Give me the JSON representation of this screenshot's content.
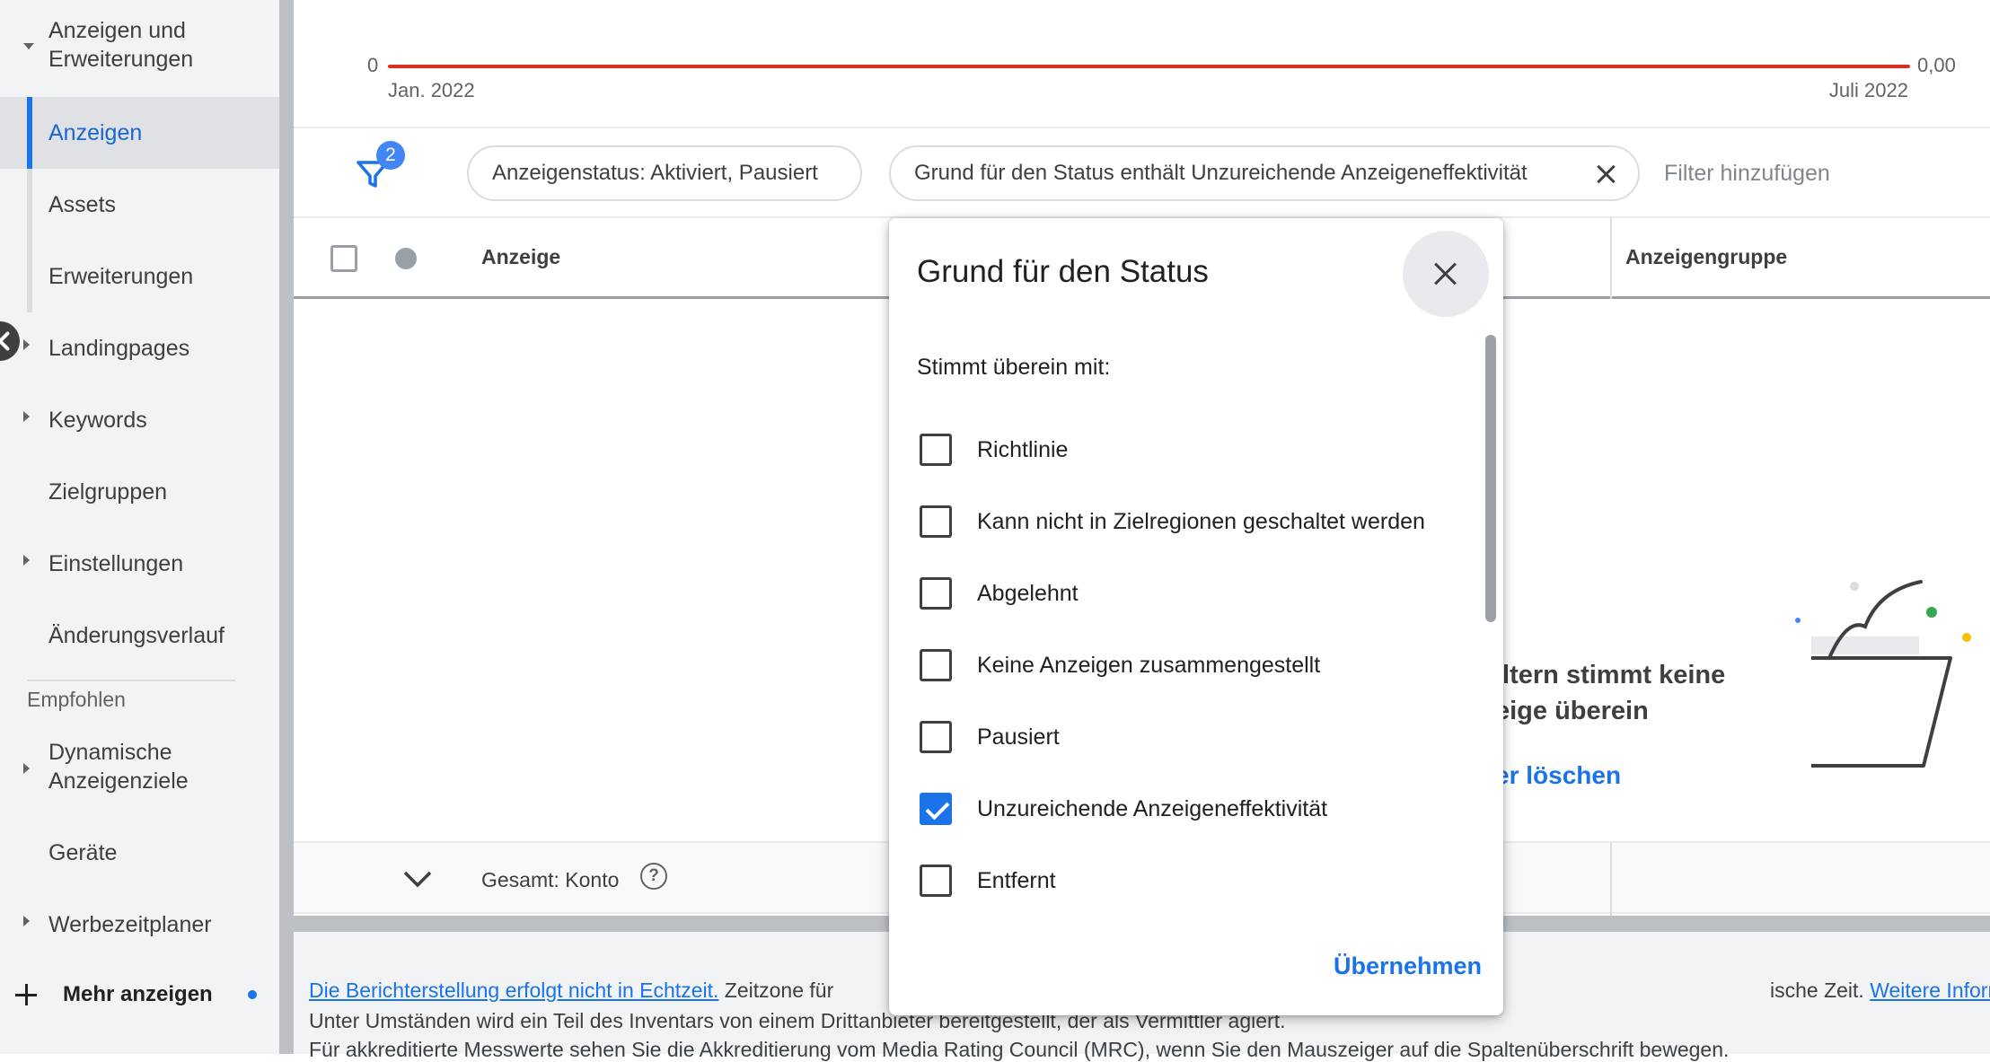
{
  "sidebar": {
    "items": [
      {
        "label": "Anzeigen und Erweiterungen",
        "caret": "down"
      },
      {
        "label": "Anzeigen",
        "active": true
      },
      {
        "label": "Assets"
      },
      {
        "label": "Erweiterungen"
      },
      {
        "label": "Landingpages",
        "caret": "right"
      },
      {
        "label": "Keywords",
        "caret": "right"
      },
      {
        "label": "Zielgruppen"
      },
      {
        "label": "Einstellungen",
        "caret": "right"
      },
      {
        "label": "Änderungsverlauf"
      }
    ],
    "section_label": "Empfohlen",
    "recommended": [
      {
        "label": "Dynamische Anzeigenziele",
        "caret": "right"
      },
      {
        "label": "Geräte"
      },
      {
        "label": "Werbezeitplaner",
        "caret": "right"
      }
    ],
    "more_label": "Mehr anzeigen"
  },
  "chart": {
    "y_left": "0",
    "y_right": "0,00",
    "x_start": "Jan. 2022",
    "x_end": "Juli 2022",
    "line_color": "#d93025"
  },
  "filter_bar": {
    "filter_count": "2",
    "chips": [
      {
        "label": "Anzeigenstatus: Aktiviert, Pausiert"
      },
      {
        "label": "Grund für den Status enthält Unzureichende Anzeigeneffektivität"
      }
    ],
    "add_filter_label": "Filter hinzufügen"
  },
  "table": {
    "columns": [
      "Anzeige",
      "Anzeigengruppe"
    ],
    "empty_line1": "iltern stimmt keine",
    "empty_line2": "eige überein",
    "empty_link": "er löschen",
    "total_label": "Gesamt: Konto"
  },
  "footer": {
    "line1_link": "Die Berichterstellung erfolgt nicht in Echtzeit.",
    "line1_text": "Zeitzone für",
    "line1_text2": "ische Zeit.",
    "line1_link2": "Weitere Informationen",
    "line2": "Unter Umständen wird ein Teil des Inventars von einem Drittanbieter bereitgestellt, der als Vermittler agiert.",
    "line3": "Für akkreditierte Messwerte sehen Sie die Akkreditierung vom Media Rating Council (MRC), wenn Sie den Mauszeiger auf die Spaltenüberschrift bewegen."
  },
  "dialog": {
    "title": "Grund für den Status",
    "subtitle": "Stimmt überein mit:",
    "options": [
      {
        "label": "Richtlinie",
        "checked": false
      },
      {
        "label": "Kann nicht in Zielregionen geschaltet werden",
        "checked": false
      },
      {
        "label": "Abgelehnt",
        "checked": false
      },
      {
        "label": "Keine Anzeigen zusammengestellt",
        "checked": false
      },
      {
        "label": "Pausiert",
        "checked": false
      },
      {
        "label": "Unzureichende Anzeigeneffektivität",
        "checked": true
      },
      {
        "label": "Entfernt",
        "checked": false
      }
    ],
    "apply_label": "Übernehmen"
  },
  "colors": {
    "accent": "#1a73e8",
    "sidebar_bg": "#f1f3f4",
    "active_bg": "#dfe1e5"
  }
}
